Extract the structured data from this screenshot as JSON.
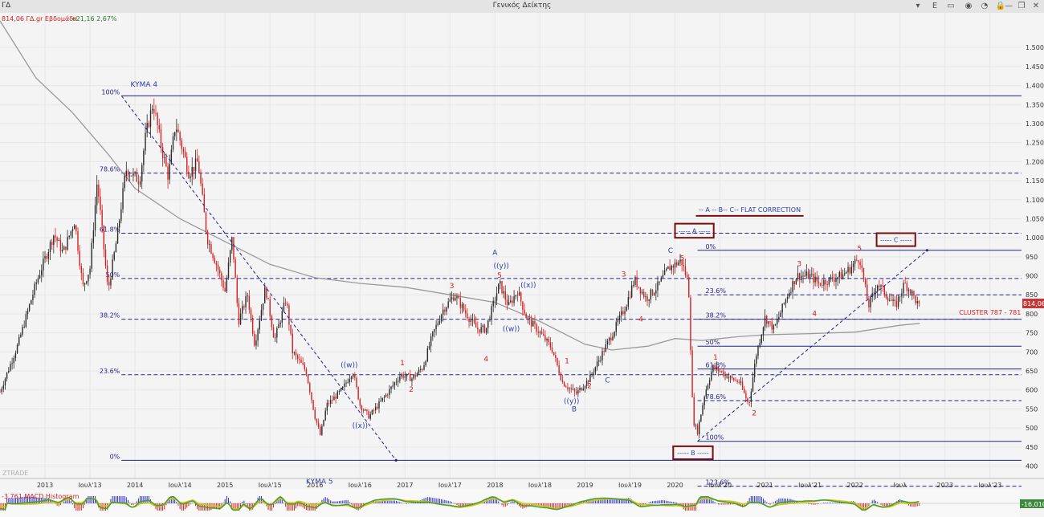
{
  "window": {
    "symbol": "ΓΔ",
    "title": "Γενικός Δείκτης",
    "controls": [
      "▾",
      "E",
      "▭",
      "◉",
      "◔",
      "🔒",
      "—",
      "❐",
      "✕"
    ]
  },
  "info": {
    "price_line": "814,06 ΓΔ.gr Εβδομάδα",
    "change": "+21,16 2,67%",
    "price_tag": "814,06",
    "watermark": "ZTRADE"
  },
  "macd": {
    "label": "-3,761 MACD Histogram",
    "value_tag": "-16,010"
  },
  "colors": {
    "up": "#2b2b2b",
    "down": "#d42020",
    "fib": "#23238c",
    "ma": "#9a9a9a",
    "wave_red": "#d42020",
    "wave_blue": "#2e3ea8",
    "box": "#7a0d0d",
    "macd_green": "#4aa02a",
    "macd_yellow": "#d8c21e"
  },
  "chart_data": {
    "type": "candlestick",
    "timeframe": "weekly",
    "ylim": [
      380,
      1570
    ],
    "x_ticks": [
      {
        "t": 2013.0,
        "label": "2013"
      },
      {
        "t": 2013.5,
        "label": "Ιουλ'13"
      },
      {
        "t": 2014.0,
        "label": "2014"
      },
      {
        "t": 2014.5,
        "label": "Ιουλ'14"
      },
      {
        "t": 2015.0,
        "label": "2015"
      },
      {
        "t": 2015.5,
        "label": "Ιουλ'15"
      },
      {
        "t": 2016.0,
        "label": "2016"
      },
      {
        "t": 2016.5,
        "label": "Ιουλ'16"
      },
      {
        "t": 2017.0,
        "label": "2017"
      },
      {
        "t": 2017.5,
        "label": "Ιουλ'17"
      },
      {
        "t": 2018.0,
        "label": "2018"
      },
      {
        "t": 2018.5,
        "label": "Ιουλ'18"
      },
      {
        "t": 2019.0,
        "label": "2019"
      },
      {
        "t": 2019.5,
        "label": "Ιουλ'19"
      },
      {
        "t": 2020.0,
        "label": "2020"
      },
      {
        "t": 2020.5,
        "label": "Ιουλ'20"
      },
      {
        "t": 2021.0,
        "label": "2021"
      },
      {
        "t": 2021.5,
        "label": "Ιουλ'21"
      },
      {
        "t": 2022.0,
        "label": "2022"
      },
      {
        "t": 2022.5,
        "label": "Ιουλ"
      },
      {
        "t": 2023.0,
        "label": "2023"
      },
      {
        "t": 2023.5,
        "label": "Ιουλ'23"
      }
    ],
    "y_ticks": [
      {
        "v": 400,
        "label": "400"
      },
      {
        "v": 450,
        "label": "450"
      },
      {
        "v": 500,
        "label": "500"
      },
      {
        "v": 550,
        "label": "550"
      },
      {
        "v": 600,
        "label": "600"
      },
      {
        "v": 650,
        "label": "650"
      },
      {
        "v": 700,
        "label": "700"
      },
      {
        "v": 750,
        "label": "750"
      },
      {
        "v": 800,
        "label": "800"
      },
      {
        "v": 850,
        "label": "850"
      },
      {
        "v": 900,
        "label": "900"
      },
      {
        "v": 950,
        "label": "950"
      },
      {
        "v": 1000,
        "label": "1.000"
      },
      {
        "v": 1050,
        "label": "1.050"
      },
      {
        "v": 1100,
        "label": "1.100"
      },
      {
        "v": 1150,
        "label": "1.150"
      },
      {
        "v": 1200,
        "label": "1.200"
      },
      {
        "v": 1250,
        "label": "1.250"
      },
      {
        "v": 1300,
        "label": "1.300"
      },
      {
        "v": 1350,
        "label": "1.350"
      },
      {
        "v": 1400,
        "label": "1.400"
      },
      {
        "v": 1450,
        "label": "1.450"
      },
      {
        "v": 1500,
        "label": "1.500"
      }
    ],
    "price_path": [
      [
        2012.5,
        595
      ],
      [
        2012.7,
        720
      ],
      [
        2012.9,
        880
      ],
      [
        2013.1,
        1010
      ],
      [
        2013.2,
        960
      ],
      [
        2013.33,
        1045
      ],
      [
        2013.42,
        870
      ],
      [
        2013.5,
        920
      ],
      [
        2013.58,
        1150
      ],
      [
        2013.7,
        860
      ],
      [
        2013.8,
        1000
      ],
      [
        2013.9,
        1180
      ],
      [
        2014.05,
        1150
      ],
      [
        2014.12,
        1270
      ],
      [
        2014.2,
        1355
      ],
      [
        2014.3,
        1230
      ],
      [
        2014.37,
        1160
      ],
      [
        2014.45,
        1300
      ],
      [
        2014.6,
        1170
      ],
      [
        2014.7,
        1200
      ],
      [
        2014.8,
        1000
      ],
      [
        2014.92,
        920
      ],
      [
        2015.0,
        860
      ],
      [
        2015.08,
        1000
      ],
      [
        2015.15,
        780
      ],
      [
        2015.25,
        850
      ],
      [
        2015.33,
        720
      ],
      [
        2015.45,
        870
      ],
      [
        2015.55,
        730
      ],
      [
        2015.68,
        840
      ],
      [
        2015.75,
        700
      ],
      [
        2015.9,
        650
      ],
      [
        2016.0,
        530
      ],
      [
        2016.06,
        480
      ],
      [
        2016.13,
        560
      ],
      [
        2016.3,
        600
      ],
      [
        2016.42,
        650
      ],
      [
        2016.5,
        560
      ],
      [
        2016.6,
        530
      ],
      [
        2016.8,
        590
      ],
      [
        2016.95,
        640
      ],
      [
        2017.08,
        630
      ],
      [
        2017.2,
        660
      ],
      [
        2017.3,
        740
      ],
      [
        2017.42,
        810
      ],
      [
        2017.55,
        850
      ],
      [
        2017.68,
        800
      ],
      [
        2017.8,
        760
      ],
      [
        2017.9,
        760
      ],
      [
        2018.05,
        880
      ],
      [
        2018.15,
        820
      ],
      [
        2018.25,
        860
      ],
      [
        2018.35,
        790
      ],
      [
        2018.5,
        750
      ],
      [
        2018.63,
        710
      ],
      [
        2018.75,
        620
      ],
      [
        2018.9,
        590
      ],
      [
        2019.05,
        630
      ],
      [
        2019.2,
        700
      ],
      [
        2019.33,
        760
      ],
      [
        2019.45,
        820
      ],
      [
        2019.55,
        890
      ],
      [
        2019.68,
        840
      ],
      [
        2019.8,
        870
      ],
      [
        2019.93,
        920
      ],
      [
        2020.07,
        940
      ],
      [
        2020.15,
        880
      ],
      [
        2020.2,
        520
      ],
      [
        2020.25,
        490
      ],
      [
        2020.33,
        590
      ],
      [
        2020.42,
        660
      ],
      [
        2020.5,
        650
      ],
      [
        2020.62,
        630
      ],
      [
        2020.72,
        620
      ],
      [
        2020.82,
        560
      ],
      [
        2020.9,
        690
      ],
      [
        2021.0,
        790
      ],
      [
        2021.1,
        760
      ],
      [
        2021.25,
        850
      ],
      [
        2021.35,
        900
      ],
      [
        2021.5,
        900
      ],
      [
        2021.6,
        880
      ],
      [
        2021.72,
        890
      ],
      [
        2021.85,
        900
      ],
      [
        2021.95,
        920
      ],
      [
        2022.05,
        950
      ],
      [
        2022.15,
        820
      ],
      [
        2022.25,
        880
      ],
      [
        2022.38,
        840
      ],
      [
        2022.45,
        820
      ],
      [
        2022.55,
        880
      ],
      [
        2022.62,
        860
      ],
      [
        2022.72,
        814
      ]
    ],
    "ma_path": [
      [
        2012.5,
        1570
      ],
      [
        2012.9,
        1420
      ],
      [
        2013.3,
        1330
      ],
      [
        2013.7,
        1220
      ],
      [
        2014.0,
        1130
      ],
      [
        2014.5,
        1050
      ],
      [
        2015.0,
        990
      ],
      [
        2015.5,
        930
      ],
      [
        2016.0,
        895
      ],
      [
        2016.5,
        880
      ],
      [
        2017.0,
        870
      ],
      [
        2017.5,
        850
      ],
      [
        2018.0,
        830
      ],
      [
        2018.5,
        780
      ],
      [
        2019.0,
        720
      ],
      [
        2019.3,
        705
      ],
      [
        2019.7,
        715
      ],
      [
        2020.0,
        735
      ],
      [
        2020.3,
        730
      ],
      [
        2020.7,
        740
      ],
      [
        2021.0,
        745
      ],
      [
        2021.5,
        748
      ],
      [
        2022.0,
        752
      ],
      [
        2022.5,
        770
      ],
      [
        2022.72,
        775
      ]
    ],
    "fib_left": {
      "t_start": 2013.85,
      "t_end": 2023.85,
      "levels": [
        {
          "label": "100%",
          "v": 1373,
          "style": "solid"
        },
        {
          "label": "78.6%",
          "v": 1170,
          "style": "dash"
        },
        {
          "label": "61.8%",
          "v": 1012,
          "style": "dash"
        },
        {
          "label": "50%",
          "v": 893,
          "style": "dash"
        },
        {
          "label": "38.2%",
          "v": 786,
          "style": "dash"
        },
        {
          "label": "23.6%",
          "v": 640,
          "style": "dash"
        },
        {
          "label": "0%",
          "v": 415,
          "style": "solid"
        }
      ]
    },
    "fib_right": {
      "t_start": 2020.25,
      "t_end": 2023.85,
      "levels": [
        {
          "label": "0%",
          "v": 967,
          "style": "solid"
        },
        {
          "label": "23.6%",
          "v": 850,
          "style": "dash"
        },
        {
          "label": "38.2%",
          "v": 786,
          "style": "dash"
        },
        {
          "label": "50%",
          "v": 715,
          "style": "solid"
        },
        {
          "label": "61.8%",
          "v": 655,
          "style": "solid"
        },
        {
          "label": "78.6%",
          "v": 572,
          "style": "dash"
        },
        {
          "label": "100%",
          "v": 465,
          "style": "solid"
        },
        {
          "label": "123.6%",
          "v": 347,
          "style": "dash"
        }
      ]
    },
    "trendlines": [
      {
        "t1": 2013.85,
        "v1": 1373,
        "t2": 2016.9,
        "v2": 415
      },
      {
        "t1": 2020.25,
        "v1": 465,
        "t2": 2022.8,
        "v2": 967
      }
    ],
    "wave_labels": [
      {
        "text": "KYMA 4",
        "t": 2014.1,
        "v": 1397,
        "color": "blue"
      },
      {
        "text": "KYMA 5",
        "t": 2016.05,
        "v": 354,
        "color": "blue"
      },
      {
        "text": "((w))",
        "t": 2016.38,
        "v": 660,
        "color": "blue"
      },
      {
        "text": "((x))",
        "t": 2016.5,
        "v": 500,
        "color": "blue"
      },
      {
        "text": "1",
        "t": 2016.97,
        "v": 665,
        "color": "red"
      },
      {
        "text": "2",
        "t": 2017.07,
        "v": 595,
        "color": "red"
      },
      {
        "text": "3",
        "t": 2017.52,
        "v": 867,
        "color": "red"
      },
      {
        "text": "4",
        "t": 2017.9,
        "v": 675,
        "color": "red"
      },
      {
        "text": "A",
        "t": 2018.0,
        "v": 955,
        "color": "blue"
      },
      {
        "text": "((y))",
        "t": 2018.07,
        "v": 920,
        "color": "blue"
      },
      {
        "text": "5",
        "t": 2018.05,
        "v": 895,
        "color": "red"
      },
      {
        "text": "((x))",
        "t": 2018.37,
        "v": 870,
        "color": "blue"
      },
      {
        "text": "((w))",
        "t": 2018.18,
        "v": 755,
        "color": "blue"
      },
      {
        "text": "1",
        "t": 2018.8,
        "v": 670,
        "color": "red"
      },
      {
        "text": "2",
        "t": 2019.05,
        "v": 605,
        "color": "red"
      },
      {
        "text": "((y))",
        "t": 2018.85,
        "v": 565,
        "color": "blue"
      },
      {
        "text": "B",
        "t": 2018.88,
        "v": 543,
        "color": "blue"
      },
      {
        "text": "C",
        "t": 2019.25,
        "v": 620,
        "color": "blue"
      },
      {
        "text": "3",
        "t": 2019.43,
        "v": 898,
        "color": "red"
      },
      {
        "text": "4",
        "t": 2019.62,
        "v": 780,
        "color": "red"
      },
      {
        "text": "C",
        "t": 2019.95,
        "v": 960,
        "color": "blue"
      },
      {
        "text": "5",
        "t": 2020.08,
        "v": 940,
        "color": "red"
      },
      {
        "text": "1",
        "t": 2020.45,
        "v": 680,
        "color": "red"
      },
      {
        "text": "2",
        "t": 2020.88,
        "v": 533,
        "color": "red"
      },
      {
        "text": "3",
        "t": 2021.38,
        "v": 925,
        "color": "red"
      },
      {
        "text": "4",
        "t": 2021.55,
        "v": 795,
        "color": "red"
      },
      {
        "text": "5",
        "t": 2022.05,
        "v": 965,
        "color": "red"
      }
    ],
    "boxes": [
      {
        "text": "----- A -----",
        "t1": 2020.0,
        "t2": 2020.43,
        "v1": 1000,
        "v2": 1037
      },
      {
        "text": "----- B -----",
        "t1": 2019.98,
        "t2": 2020.42,
        "v1": 418,
        "v2": 452
      },
      {
        "text": "----- C -----",
        "t1": 2022.24,
        "t2": 2022.67,
        "v1": 978,
        "v2": 1012
      }
    ],
    "annotations": [
      {
        "text": "-- A -- B-- C--   FLAT CORRECTION",
        "t": 2020.83,
        "v": 1068,
        "underline": true,
        "color": "blue"
      },
      {
        "text": "CLUSTER 787 - 781",
        "t": 2023.5,
        "v": 798,
        "color": "red"
      }
    ]
  }
}
